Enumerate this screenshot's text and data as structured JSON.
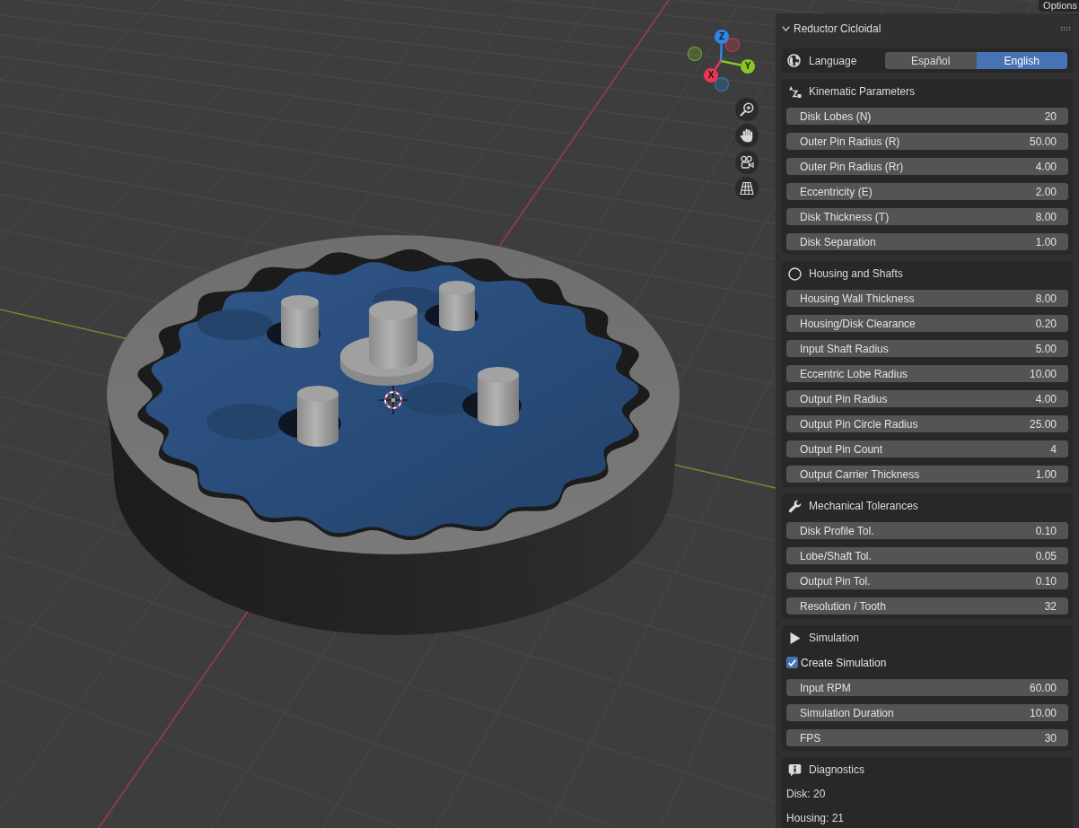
{
  "viewport": {
    "options_button": "Options",
    "gizmo": {
      "axes": [
        {
          "label": "Z",
          "color": "#2f86e4"
        },
        {
          "label": "Y",
          "color": "#8ac524"
        },
        {
          "label": "X",
          "color": "#eb3552"
        }
      ]
    }
  },
  "sidebar": {
    "title": "Reductor Cicloidal",
    "expanded": true,
    "language": {
      "label": "Language",
      "options": [
        {
          "label": "Español",
          "selected": false
        },
        {
          "label": "English",
          "selected": true
        }
      ]
    },
    "sections": [
      {
        "title": "Kinematic Parameters",
        "items": [
          {
            "kind": "number",
            "label": "Disk Lobes (N)",
            "value": "20"
          },
          {
            "kind": "number",
            "label": "Outer Pin Radius (R)",
            "value": "50.00"
          },
          {
            "kind": "number",
            "label": "Outer Pin Radius (Rr)",
            "value": "4.00"
          },
          {
            "kind": "number",
            "label": "Eccentricity (E)",
            "value": "2.00"
          },
          {
            "kind": "number",
            "label": "Disk Thickness (T)",
            "value": "8.00"
          },
          {
            "kind": "number",
            "label": "Disk Separation",
            "value": "1.00"
          }
        ]
      },
      {
        "title": "Housing and Shafts",
        "items": [
          {
            "kind": "number",
            "label": "Housing Wall Thickness",
            "value": "8.00"
          },
          {
            "kind": "number",
            "label": "Housing/Disk Clearance",
            "value": "0.20"
          },
          {
            "kind": "number",
            "label": "Input Shaft Radius",
            "value": "5.00"
          },
          {
            "kind": "number",
            "label": "Eccentric Lobe Radius",
            "value": "10.00"
          },
          {
            "kind": "number",
            "label": "Output Pin Radius",
            "value": "4.00"
          },
          {
            "kind": "number",
            "label": "Output Pin Circle Radius",
            "value": "25.00"
          },
          {
            "kind": "number",
            "label": "Output Pin Count",
            "value": "4"
          },
          {
            "kind": "number",
            "label": "Output Carrier Thickness",
            "value": "1.00"
          }
        ]
      },
      {
        "title": "Mechanical Tolerances",
        "items": [
          {
            "kind": "number",
            "label": "Disk Profile Tol.",
            "value": "0.10"
          },
          {
            "kind": "number",
            "label": "Lobe/Shaft Tol.",
            "value": "0.05"
          },
          {
            "kind": "number",
            "label": "Output Pin Tol.",
            "value": "0.10"
          },
          {
            "kind": "number",
            "label": "Resolution / Tooth",
            "value": "32"
          }
        ]
      },
      {
        "title": "Simulation",
        "items": [
          {
            "kind": "checkbox",
            "label": "Create Simulation",
            "checked": true
          },
          {
            "kind": "number",
            "label": "Input RPM",
            "value": "60.00"
          },
          {
            "kind": "number",
            "label": "Simulation Duration",
            "value": "10.00"
          },
          {
            "kind": "number",
            "label": "FPS",
            "value": "30"
          }
        ]
      },
      {
        "title": "Diagnostics",
        "items": [
          {
            "kind": "text",
            "text": "Disk: 20"
          },
          {
            "kind": "text",
            "text": "Housing: 21"
          }
        ]
      }
    ]
  }
}
